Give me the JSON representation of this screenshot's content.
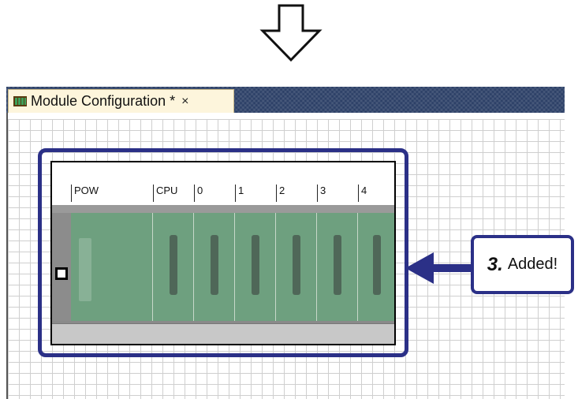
{
  "tab": {
    "title": "Module Configuration *",
    "close": "×"
  },
  "rack": {
    "slots": [
      {
        "label": "POW"
      },
      {
        "label": "CPU"
      },
      {
        "label": "0"
      },
      {
        "label": "1"
      },
      {
        "label": "2"
      },
      {
        "label": "3"
      },
      {
        "label": "4"
      }
    ]
  },
  "callout": {
    "step": "3.",
    "text": "Added!"
  },
  "colors": {
    "accent": "#2b3087",
    "module_green": "#6ea07f",
    "tab_bg": "#fdf5dc",
    "tabstrip_bg": "#2b3f66"
  },
  "icons": {
    "down_arrow": "down-arrow-icon",
    "tab_icon": "module-configuration-icon"
  }
}
